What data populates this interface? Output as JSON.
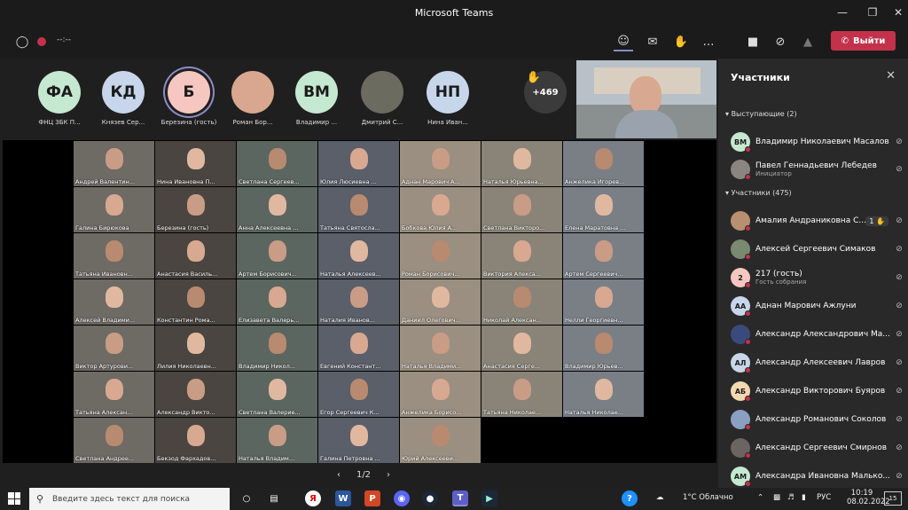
{
  "window": {
    "title": "Microsoft Teams"
  },
  "toolbar": {
    "timer": "--:--",
    "leave_label": "Выйти"
  },
  "avatar_strip": [
    {
      "initials": "ФА",
      "name": "ФНЦ ЗБК П...",
      "color": "#c5e8d0"
    },
    {
      "initials": "КД",
      "name": "Князев Сер...",
      "color": "#c7d6ea"
    },
    {
      "initials": "Б",
      "name": "Березина (гость)",
      "color": "#f5c7c0"
    },
    {
      "initials": "",
      "name": "Роман Бор...",
      "color": "#d9a78f"
    },
    {
      "initials": "ВМ",
      "name": "Владимир ...",
      "color": "#c5e8d0"
    },
    {
      "initials": "",
      "name": "Дмитрий С...",
      "color": "#6b6b60"
    },
    {
      "initials": "НП",
      "name": "Нина Иван...",
      "color": "#c7d6ea"
    }
  ],
  "raised_hand": {
    "icon": "✋",
    "count": "+469"
  },
  "video_grid": [
    {
      "name": "Андрей Валентин..."
    },
    {
      "name": "Нина Ивановна П..."
    },
    {
      "name": "Светлана Сергеев..."
    },
    {
      "name": "Юлия Люсиевна ..."
    },
    {
      "name": "Аднан Марович А..."
    },
    {
      "name": "Наталья Юрьевна..."
    },
    {
      "name": "Анжелика Игорев..."
    },
    {
      "name": "Галина Бирюкова"
    },
    {
      "name": "Березина (гость)"
    },
    {
      "name": "Анна Алексеевна ..."
    },
    {
      "name": "Татьяна Святосла..."
    },
    {
      "name": "Бобкова Юлия А..."
    },
    {
      "name": "Светлана Викторо..."
    },
    {
      "name": "Елена Маратовна ..."
    },
    {
      "name": "Татьяна Ивановн..."
    },
    {
      "name": "Анастасия Василь..."
    },
    {
      "name": "Артем Борисович..."
    },
    {
      "name": "Наталья Алексеев..."
    },
    {
      "name": "Роман Борисович..."
    },
    {
      "name": "Виктория Алекса..."
    },
    {
      "name": "Артем Сергеевич..."
    },
    {
      "name": "Алексей Владими..."
    },
    {
      "name": "Константин Рома..."
    },
    {
      "name": "Елизавета Валерь..."
    },
    {
      "name": "Наталия Иванов..."
    },
    {
      "name": "Даниил Олегович..."
    },
    {
      "name": "Николай Алексан..."
    },
    {
      "name": "Нелли Георгиевн..."
    },
    {
      "name": "Виктор Артурови..."
    },
    {
      "name": "Лилия Николаевн..."
    },
    {
      "name": "Владимир Никол..."
    },
    {
      "name": "Евгений Констант..."
    },
    {
      "name": "Наталья Владими..."
    },
    {
      "name": "Анастасия Серге..."
    },
    {
      "name": "Владимир Юрьев..."
    },
    {
      "name": "Татьяна Алексан..."
    },
    {
      "name": "Александр Викто..."
    },
    {
      "name": "Светлана Валерие..."
    },
    {
      "name": "Егор Сергеевич К..."
    },
    {
      "name": "Анжелика Борисо..."
    },
    {
      "name": "Татьяна Николае..."
    },
    {
      "name": "Наталья Николае..."
    },
    {
      "name": "Светлана Андрее..."
    },
    {
      "name": "Бекзод Фархадов..."
    },
    {
      "name": "Наталья Владим..."
    },
    {
      "name": "Галина Петровна ..."
    },
    {
      "name": "Юрий Алексееви..."
    }
  ],
  "pager": {
    "label": "1/2"
  },
  "participants_panel": {
    "title": "Участники",
    "presenters_label": "Выступающие (2)",
    "attendees_label": "Участники (475)",
    "presenters": [
      {
        "initials": "ВМ",
        "name": "Владимир Николаевич Масалов",
        "sub": "",
        "color": "#c5e8d0"
      },
      {
        "initials": "",
        "name": "Павел Геннадьевич Лебедев",
        "sub": "Инициатор",
        "color": "#8a8580"
      }
    ],
    "attendees": [
      {
        "initials": "",
        "name": "Амалия Андраниковна С...",
        "sub": "",
        "color": "#b89070",
        "hand": "1 ✋"
      },
      {
        "initials": "",
        "name": "Алексей Сергеевич Симаков",
        "sub": "",
        "color": "#7a8a70"
      },
      {
        "initials": "2",
        "name": "217 (гость)",
        "sub": "Гость собрания",
        "color": "#f5c7c0"
      },
      {
        "initials": "АА",
        "name": "Аднан Марович Ажлуни",
        "sub": "",
        "color": "#c7d6ea"
      },
      {
        "initials": "",
        "name": "Александр Александрович Ма...",
        "sub": "",
        "color": "#3a4a7a"
      },
      {
        "initials": "АЛ",
        "name": "Александр Алексеевич Лавров",
        "sub": "",
        "color": "#c7d6ea"
      },
      {
        "initials": "АБ",
        "name": "Александр Викторович Буяров",
        "sub": "",
        "color": "#f3d8b0"
      },
      {
        "initials": "",
        "name": "Александр Романович Соколов",
        "sub": "",
        "color": "#8aa0c0"
      },
      {
        "initials": "",
        "name": "Александр Сергеевич Смирнов",
        "sub": "",
        "color": "#6a6560"
      },
      {
        "initials": "АМ",
        "name": "Александра Ивановна Малько...",
        "sub": "",
        "color": "#c5e8d0"
      }
    ]
  },
  "taskbar": {
    "search_placeholder": "Введите здесь текст для поиска",
    "weather": "1°C Облачно",
    "lang": "РУС",
    "time": "10:19",
    "date": "08.02.2022",
    "notifications": "15"
  }
}
